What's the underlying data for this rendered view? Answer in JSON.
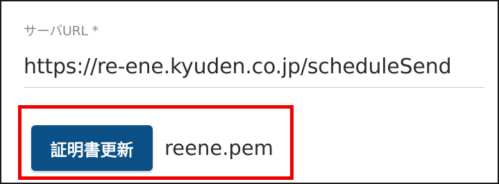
{
  "server_url_field": {
    "label": "サーバURL *",
    "value": "https://re-ene.kyuden.co.jp/scheduleSend"
  },
  "certificate": {
    "renew_button_label": "証明書更新",
    "file_name": "reene.pem",
    "highlight_color": "#ee0000"
  },
  "colors": {
    "button_background": "#0a4f86",
    "label_text": "#8a8a8a",
    "value_text": "#2b2b2b"
  }
}
